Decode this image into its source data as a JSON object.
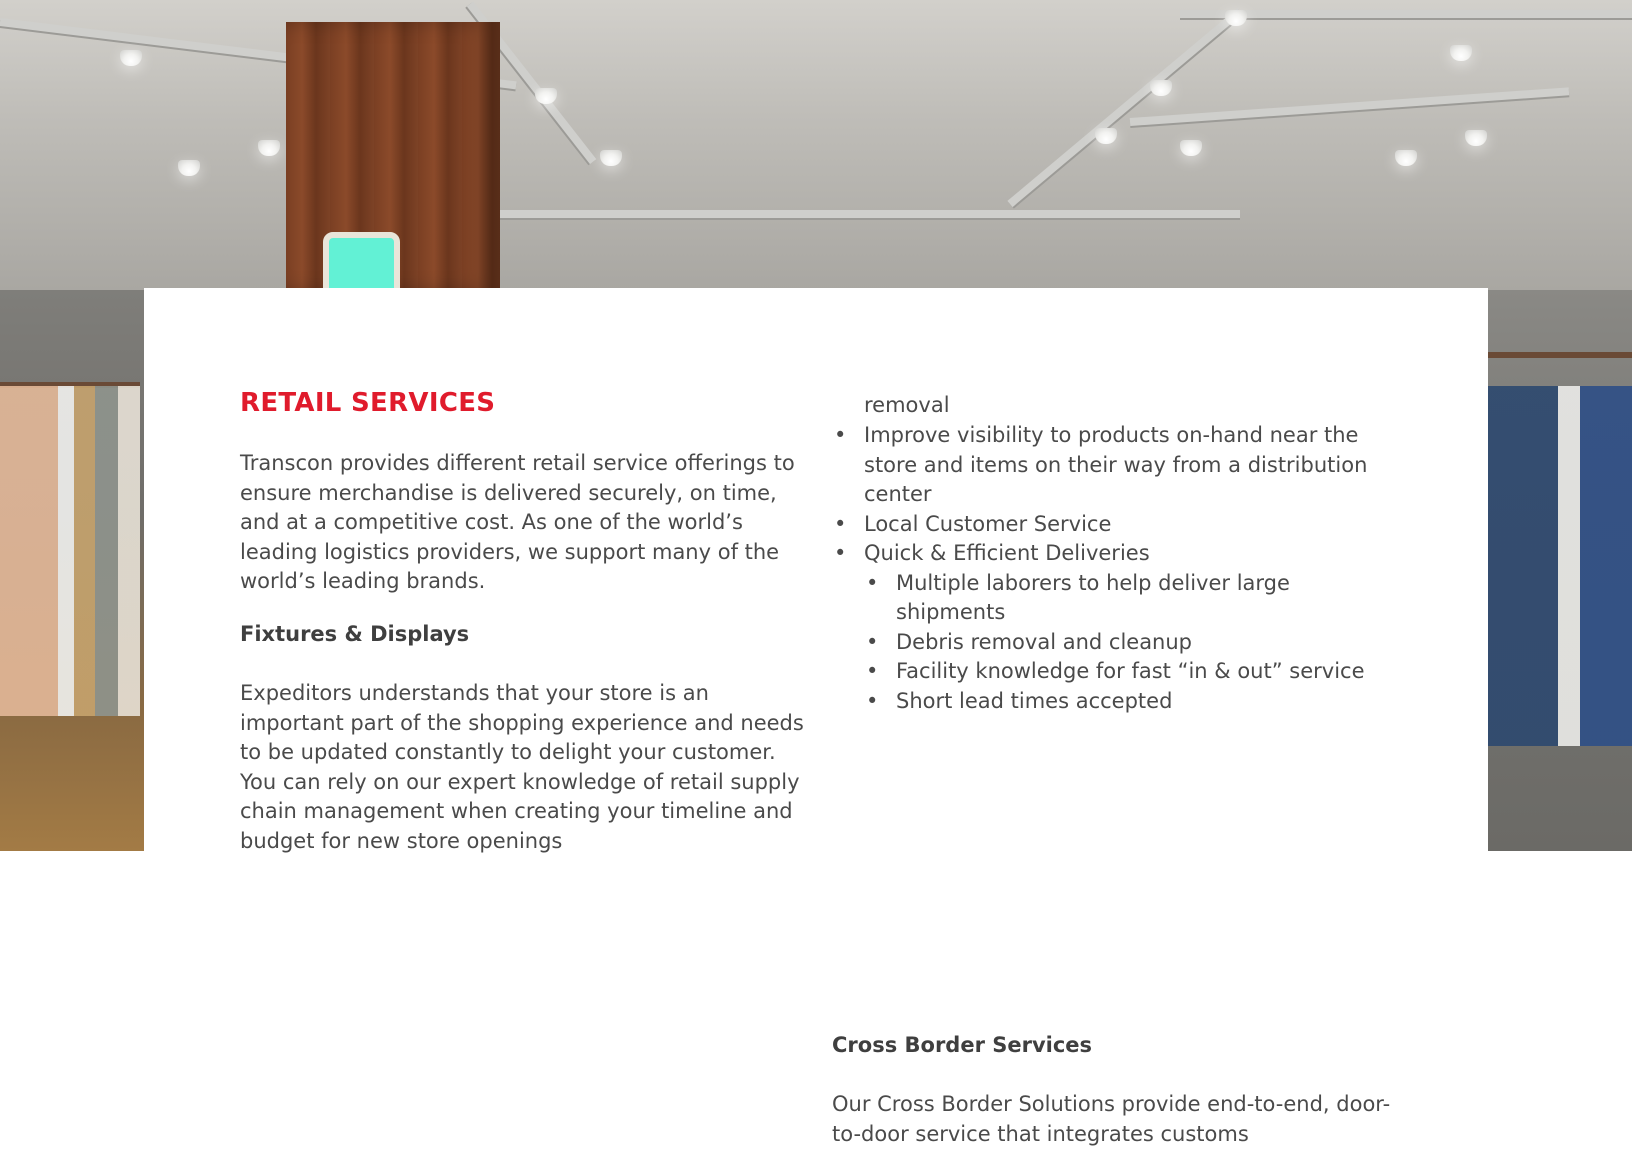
{
  "hero": {
    "alt": "Retail clothing store interior",
    "accent_color": "#e01b2c"
  },
  "retail": {
    "title": "RETAIL SERVICES",
    "intro": "Transcon provides different retail service offerings to ensure merchandise is delivered securely, on time, and at a competitive cost. As one of the world’s leading logistics providers, we support many of the world’s leading brands.",
    "fixtures_heading": "Fixtures & Displays",
    "fixtures_body": "Expeditors understands that your store is an important part of the shopping experience and needs to be updated constantly to delight your customer. You can rely on our expert knowledge of retail supply chain management when creating your timeline and budget for new store openings"
  },
  "right_col": {
    "continuation": "removal",
    "bullets": [
      "Improve visibility to products on-hand near the store and items on their way from a distribution center",
      "Local Customer Service",
      "Quick & Efficient Deliveries"
    ],
    "sub_bullets": [
      "Multiple laborers to help deliver large shipments",
      "Debris removal and cleanup",
      "Facility knowledge for fast “in & out” service",
      "Short lead times accepted"
    ],
    "cross_border_heading": "Cross Border Services",
    "cross_border_body": "Our Cross Border Solutions provide end-to-end, door-to-door service that integrates customs"
  }
}
